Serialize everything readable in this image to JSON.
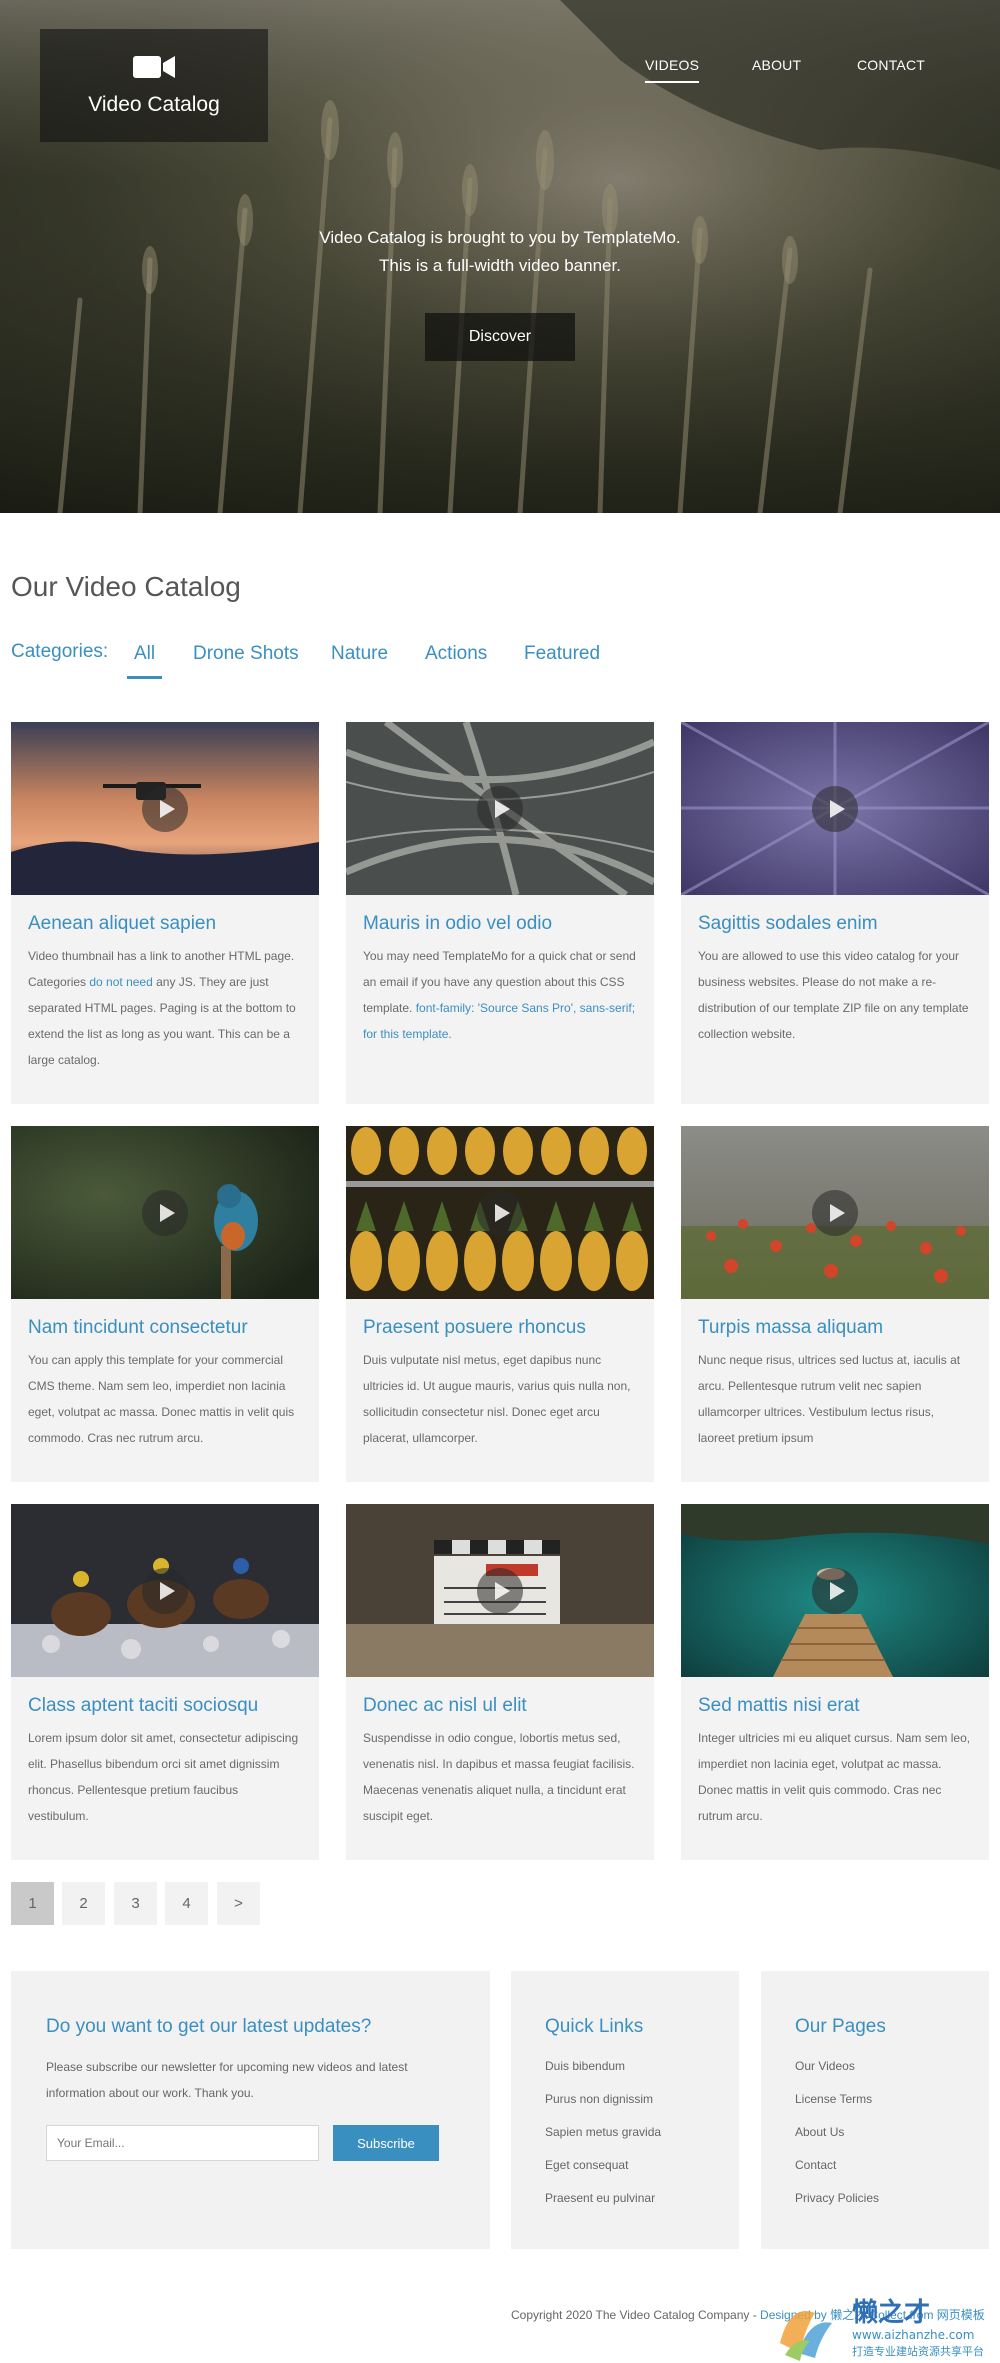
{
  "header": {
    "brand": "Video Catalog",
    "nav": [
      "VIDEOS",
      "ABOUT",
      "CONTACT"
    ],
    "hero_line1": "Video Catalog is brought to you by TemplateMo.",
    "hero_line2": "This is a full-width video banner.",
    "discover_label": "Discover"
  },
  "catalog": {
    "title": "Our Video Catalog",
    "categories_label": "Categories:",
    "categories": [
      "All",
      "Drone Shots",
      "Nature",
      "Actions",
      "Featured"
    ]
  },
  "cards": [
    {
      "title": "Aenean aliquet sapien",
      "thumb": "drone-sunset",
      "text1": "Video thumbnail has a link to another HTML page. Categories ",
      "link": "do not need",
      "text2": " any JS. They are just separated HTML pages. Paging is at the bottom to extend the list as long as you want. This can be a large catalog."
    },
    {
      "title": "Mauris in odio vel odio",
      "thumb": "highway-interchange",
      "text1": "You may need TemplateMo for a quick chat or send an email if you have any question about this CSS template. ",
      "link": "font-family: 'Source Sans Pro', sans-serif; for this template.",
      "text2": ""
    },
    {
      "title": "Sagittis sodales enim",
      "thumb": "lavender-field",
      "text1": "You are allowed to use this video catalog for your business websites. Please do not make a re-distribution of our template ZIP file on any template collection website.",
      "link": "",
      "text2": ""
    },
    {
      "title": "Nam tincidunt consectetur",
      "thumb": "kingfisher-bird",
      "text1": "You can apply this template for your commercial CMS theme. Nam sem leo, imperdiet non lacinia eget, volutpat ac massa. Donec mattis in velit quis commodo. Cras nec rutrum arcu.",
      "link": "",
      "text2": ""
    },
    {
      "title": "Praesent posuere rhoncus",
      "thumb": "pineapples",
      "text1": "Duis vulputate nisl metus, eget dapibus nunc ultricies id. Ut augue mauris, varius quis nulla non, sollicitudin consectetur nisl. Donec eget arcu placerat, ullamcorper.",
      "link": "",
      "text2": ""
    },
    {
      "title": "Turpis massa aliquam",
      "thumb": "poppy-meadow",
      "text1": "Nunc neque risus, ultrices sed luctus at, iaculis at arcu. Pellentesque rutrum velit nec sapien ullamcorper ultrices. Vestibulum lectus risus, laoreet pretium ipsum",
      "link": "",
      "text2": ""
    },
    {
      "title": "Class aptent taciti sociosqu",
      "thumb": "horse-race",
      "text1": "Lorem ipsum dolor sit amet, consectetur adipiscing elit. Phasellus bibendum orci sit amet dignissim rhoncus. Pellentesque pretium faucibus vestibulum.",
      "link": "",
      "text2": ""
    },
    {
      "title": "Donec ac nisl ul elit",
      "thumb": "film-clapperboard",
      "text1": "Suspendisse in odio congue, lobortis metus sed, venenatis nisl. In dapibus et massa feugiat facilisis. Maecenas venenatis aliquet nulla, a tincidunt erat suscipit eget.",
      "link": "",
      "text2": ""
    },
    {
      "title": "Sed mattis nisi erat",
      "thumb": "lake-swimmer",
      "text1": "Integer ultricies mi eu aliquet cursus. Nam sem leo, imperdiet non lacinia eget, volutpat ac massa. Donec mattis in velit quis commodo. Cras nec rutrum arcu.",
      "link": "",
      "text2": ""
    }
  ],
  "pagination": [
    "1",
    "2",
    "3",
    "4",
    ">"
  ],
  "footer": {
    "newsletter_title": "Do you want to get our latest updates?",
    "newsletter_text": "Please subscribe our newsletter for upcoming new videos and latest information about our work. Thank you.",
    "email_placeholder": "Your Email...",
    "subscribe_label": "Subscribe",
    "quick_links_title": "Quick Links",
    "quick_links": [
      "Duis bibendum",
      "Purus non dignissim",
      "Sapien metus gravida",
      "Eget consequat",
      "Praesent eu pulvinar"
    ],
    "pages_title": "Our Pages",
    "pages": [
      "Our Videos",
      "License Terms",
      "About Us",
      "Contact",
      "Privacy Policies"
    ],
    "copyright_text": "Copyright 2020 The Video Catalog Company - ",
    "copyright_link": "Designed by 懒之才 Collect from 网页模板",
    "watermark_name": "懒之才",
    "watermark_url": "www.aizhanzhe.com",
    "watermark_tagline": "打造专业建站资源共享平台"
  },
  "colors": {
    "accent": "#3a8fc1",
    "card_bg": "#f3f3f3"
  }
}
